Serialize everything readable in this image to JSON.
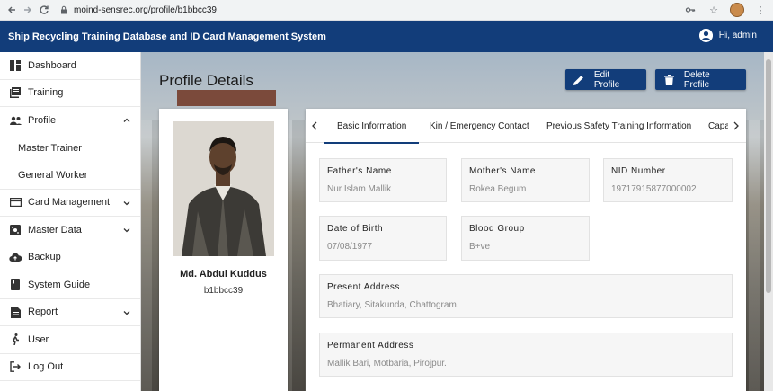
{
  "browser": {
    "url": "moind-sensrec.org/profile/b1bbcc39"
  },
  "header": {
    "title": "Ship Recycling Training Database and ID Card Management System",
    "user_greeting": "Hi, admin"
  },
  "sidebar": {
    "items": [
      {
        "label": "Dashboard",
        "icon": "dashboard-icon"
      },
      {
        "label": "Training",
        "icon": "training-icon"
      },
      {
        "label": "Profile",
        "icon": "people-icon",
        "expanded": true
      },
      {
        "label": "Master Trainer"
      },
      {
        "label": "General Worker"
      },
      {
        "label": "Card Management",
        "icon": "card-icon"
      },
      {
        "label": "Master Data",
        "icon": "data-icon"
      },
      {
        "label": "Backup",
        "icon": "cloud-upload-icon"
      },
      {
        "label": "System Guide",
        "icon": "book-icon"
      },
      {
        "label": "Report",
        "icon": "report-icon"
      },
      {
        "label": "User",
        "icon": "walking-user-icon"
      },
      {
        "label": "Log Out",
        "icon": "logout-icon"
      }
    ]
  },
  "main": {
    "page_title": "Profile Details",
    "edit_label": "Edit Profile",
    "delete_label": "Delete Profile"
  },
  "profile": {
    "name": "Md. Abdul Kuddus",
    "id": "b1bbcc39"
  },
  "tabs": [
    {
      "label": "Basic Information",
      "active": true
    },
    {
      "label": "Kin / Emergency Contact"
    },
    {
      "label": "Previous Safety Training Information"
    },
    {
      "label": "Capa"
    }
  ],
  "fields": {
    "father_label": "Father's Name",
    "father_value": "Nur Islam Mallik",
    "mother_label": "Mother's Name",
    "mother_value": "Rokea Begum",
    "nid_label": "NID Number",
    "nid_value": "19717915877000002",
    "dob_label": "Date of Birth",
    "dob_value": "07/08/1977",
    "blood_label": "Blood Group",
    "blood_value": "B+ve",
    "present_label": "Present Address",
    "present_value": "Bhatiary, Sitakunda, Chattogram.",
    "permanent_label": "Permanent Address",
    "permanent_value": "Mallik Bari, Motbaria, Pirojpur."
  },
  "colors": {
    "primary": "#123d7a",
    "field_bg": "#f6f6f6"
  }
}
